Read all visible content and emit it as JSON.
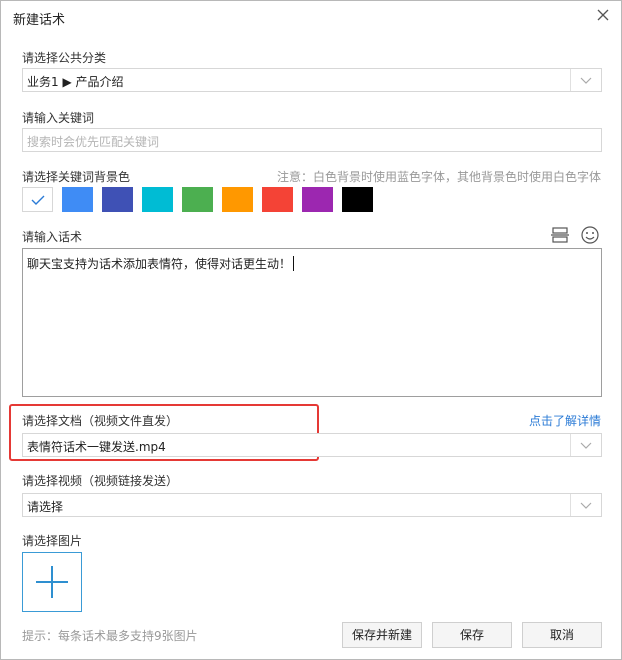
{
  "dialog": {
    "title": "新建话术"
  },
  "category": {
    "label": "请选择公共分类",
    "value": "业务1 ▶ 产品介绍"
  },
  "keyword": {
    "label": "请输入关键词",
    "placeholder": "搜索时会优先匹配关键词"
  },
  "bg_color": {
    "label": "请选择关键词背景色",
    "note": "注意：白色背景时使用蓝色字体，其他背景色时使用白色字体",
    "colors": [
      "#ffffff",
      "#3f8cf5",
      "#3f51b5",
      "#00bcd4",
      "#4caf50",
      "#ff9800",
      "#f44336",
      "#9c27b0",
      "#000000"
    ],
    "selected": "#ffffff"
  },
  "script": {
    "label": "请输入话术",
    "content": "聊天宝支持为话术添加表情符，使得对话更生动！"
  },
  "document": {
    "label": "请选择文档（视频文件直发）",
    "link": "点击了解详情",
    "value": "表情符话术一键发送.mp4"
  },
  "video": {
    "label": "请选择视频（视频链接发送）",
    "value": "请选择"
  },
  "image": {
    "label": "请选择图片"
  },
  "footer": {
    "hint": "提示：每条话术最多支持9张图片",
    "save_new": "保存并新建",
    "save": "保存",
    "cancel": "取消"
  },
  "icons": [
    "close-icon",
    "chevron-down-icon",
    "check-icon",
    "split-icon",
    "emoji-icon",
    "plus-icon"
  ],
  "accent_color": "#2b7bd6",
  "highlight_color": "#e53935"
}
